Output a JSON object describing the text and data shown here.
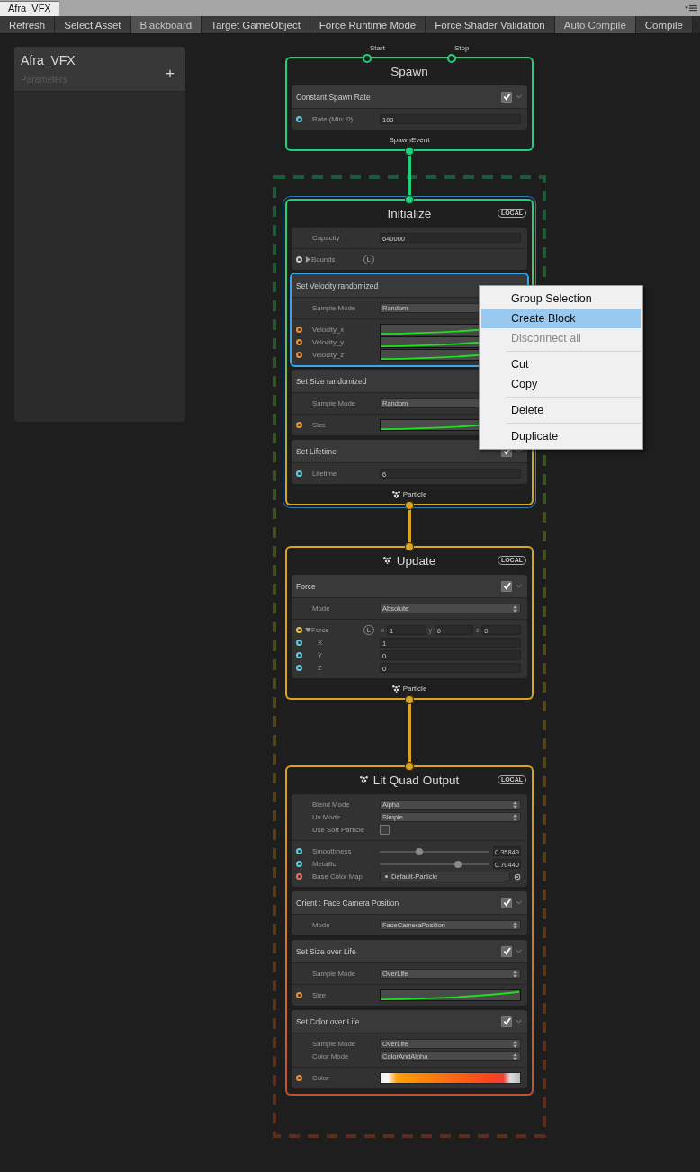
{
  "window_tab": {
    "title": "Afra_VFX",
    "selected": true
  },
  "toolbar": [
    {
      "label": "Refresh",
      "selected": false
    },
    {
      "label": "Select Asset",
      "selected": false
    },
    {
      "label": "Blackboard",
      "selected": true
    },
    {
      "label": "Target GameObject",
      "selected": false
    },
    {
      "label": "Force Runtime Mode",
      "selected": false
    },
    {
      "label": "Force Shader Validation",
      "selected": false
    },
    {
      "label": "Auto Compile",
      "selected": true
    },
    {
      "label": "Compile",
      "selected": false
    }
  ],
  "blackboard": {
    "title": "Afra_VFX",
    "subtitle": "Parameters",
    "add": "+"
  },
  "contexts": [
    {
      "kind": "spawn",
      "title": "Spawn",
      "color": "#1fd17a",
      "selected": false,
      "in_ports": [
        "Start",
        "Stop"
      ],
      "out": {
        "label": "SpawnEvent",
        "color": "#1fd17a"
      },
      "blocks": [
        {
          "title": "Constant Spawn Rate",
          "enabled": true,
          "selected": false,
          "sections": [
            [
              {
                "kind": "field",
                "label": "Rate (Min: 0)",
                "value": "100",
                "color": "#5ecde0"
              }
            ]
          ]
        }
      ]
    },
    {
      "kind": "initialize",
      "title": "Initialize",
      "badge": "LOCAL",
      "color": "#1fd17a",
      "selected": true,
      "in_port": true,
      "out": {
        "label": "Particle",
        "icon": true,
        "color": "#d9a520"
      },
      "sections": [
        [
          {
            "kind": "field",
            "label": "Capacity",
            "value": "640000"
          }
        ],
        [
          {
            "kind": "foldout",
            "label": "Bounds",
            "space": "L",
            "expanded": false,
            "color": "#c8c8c8"
          }
        ]
      ],
      "blocks": [
        {
          "title": "Set Velocity randomized",
          "selected": true,
          "sections": [
            [
              {
                "kind": "dropdown",
                "label": "Sample Mode",
                "value": "Random"
              }
            ],
            [
              {
                "kind": "curve",
                "label": "Velocity_x",
                "color": "#e8923a"
              },
              {
                "kind": "curve",
                "label": "Velocity_y",
                "color": "#e8923a"
              },
              {
                "kind": "curve",
                "label": "Velocity_z",
                "color": "#e8923a"
              }
            ]
          ]
        },
        {
          "title": "Set Size randomized",
          "selected": false,
          "sections": [
            [
              {
                "kind": "dropdown",
                "label": "Sample Mode",
                "value": "Random"
              }
            ],
            [
              {
                "kind": "curve",
                "label": "Size",
                "color": "#e8923a"
              }
            ]
          ]
        },
        {
          "title": "Set Lifetime",
          "enabled": true,
          "selected": false,
          "sections": [
            [
              {
                "kind": "field",
                "label": "Lifetime",
                "value": "6",
                "color": "#5ecde0"
              }
            ]
          ]
        }
      ]
    },
    {
      "kind": "update",
      "title": "Update",
      "icon": true,
      "badge": "LOCAL",
      "color": "#d9a520",
      "selected": false,
      "in_port": true,
      "out": {
        "label": "Particle",
        "icon": true,
        "color": "#d9a520"
      },
      "blocks": [
        {
          "title": "Force",
          "enabled": true,
          "selected": false,
          "sections": [
            [
              {
                "kind": "dropdown",
                "label": "Mode",
                "value": "Absolute"
              }
            ],
            [
              {
                "kind": "vector",
                "label": "Force",
                "space": "L",
                "expanded": true,
                "color": "#e8c33a",
                "components": [
                  {
                    "axis": "x",
                    "value": "1"
                  },
                  {
                    "axis": "y",
                    "value": "0"
                  },
                  {
                    "axis": "z",
                    "value": "0"
                  }
                ],
                "children": [
                  {
                    "kind": "field",
                    "label": "X",
                    "value": "1",
                    "color": "#5ecde0"
                  },
                  {
                    "kind": "field",
                    "label": "Y",
                    "value": "0",
                    "color": "#5ecde0"
                  },
                  {
                    "kind": "field",
                    "label": "Z",
                    "value": "0",
                    "color": "#5ecde0"
                  }
                ]
              }
            ]
          ]
        }
      ]
    },
    {
      "kind": "output",
      "title": "Lit Quad Output",
      "icon": true,
      "badge": "LOCAL",
      "color": "#d9a520",
      "selected": false,
      "in_port": true,
      "sections": [
        [
          {
            "kind": "dropdown",
            "label": "Blend Mode",
            "value": "Alpha"
          },
          {
            "kind": "dropdown",
            "label": "Uv Mode",
            "value": "Simple"
          },
          {
            "kind": "checkbox",
            "label": "Use Soft Particle",
            "checked": false
          }
        ],
        [
          {
            "kind": "slider",
            "label": "Smoothness",
            "level": 0.36,
            "value": "0.35849",
            "color": "#5ecde0"
          },
          {
            "kind": "slider",
            "label": "Metallic",
            "level": 0.71,
            "value": "0.70440",
            "color": "#5ecde0"
          },
          {
            "kind": "object",
            "label": "Base Color Map",
            "value": "Default-Particle",
            "color": "#e07070"
          }
        ]
      ],
      "blocks": [
        {
          "title": "Orient : Face Camera Position",
          "enabled": true,
          "selected": false,
          "sections": [
            [
              {
                "kind": "dropdown",
                "label": "Mode",
                "value": "FaceCameraPosition"
              }
            ]
          ]
        },
        {
          "title": "Set Size over Life",
          "enabled": true,
          "selected": false,
          "sections": [
            [
              {
                "kind": "dropdown",
                "label": "Sample Mode",
                "value": "OverLife"
              }
            ],
            [
              {
                "kind": "curve",
                "label": "Size",
                "color": "#e8923a"
              }
            ]
          ]
        },
        {
          "title": "Set Color over Life",
          "enabled": true,
          "selected": false,
          "sections": [
            [
              {
                "kind": "dropdown",
                "label": "Sample Mode",
                "value": "OverLife"
              },
              {
                "kind": "dropdown",
                "label": "Color Mode",
                "value": "ColorAndAlpha"
              }
            ],
            [
              {
                "kind": "gradient",
                "label": "Color",
                "color": "#e8923a"
              }
            ]
          ]
        }
      ]
    }
  ],
  "context_menu": {
    "items": [
      {
        "kind": "item",
        "label": "Group Selection",
        "selected": false,
        "disabled": false
      },
      {
        "kind": "item",
        "label": "Create Block",
        "selected": true,
        "disabled": false
      },
      {
        "kind": "item",
        "label": "Disconnect all",
        "selected": false,
        "disabled": true
      },
      {
        "kind": "separator"
      },
      {
        "kind": "item",
        "label": "Cut",
        "selected": false,
        "disabled": false
      },
      {
        "kind": "item",
        "label": "Copy",
        "selected": false,
        "disabled": false
      },
      {
        "kind": "separator"
      },
      {
        "kind": "item",
        "label": "Delete",
        "selected": false,
        "disabled": false
      },
      {
        "kind": "separator"
      },
      {
        "kind": "item",
        "label": "Duplicate",
        "selected": false,
        "disabled": false
      }
    ]
  }
}
